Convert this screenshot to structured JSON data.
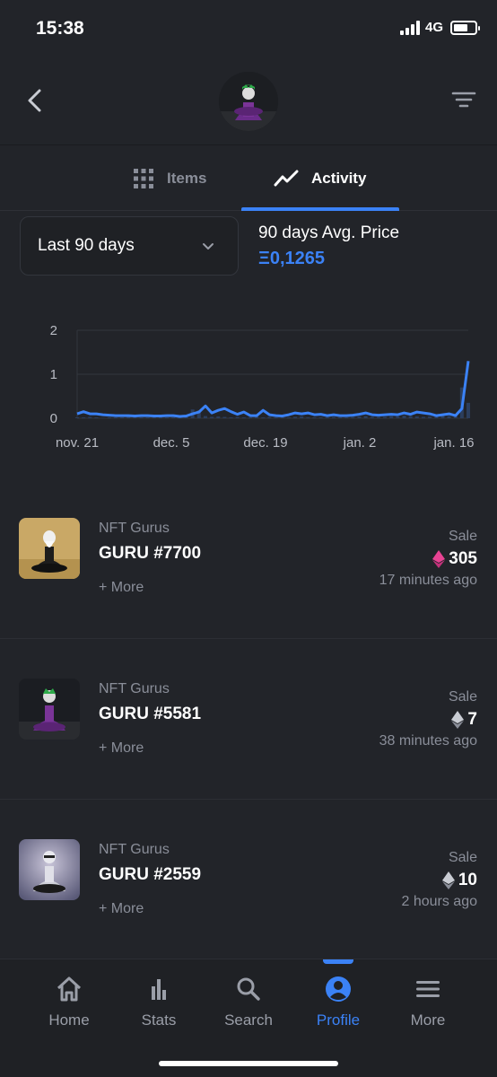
{
  "status_bar": {
    "time": "15:38",
    "network": "4G"
  },
  "tabs": [
    {
      "label": "Items",
      "icon": "grid-icon",
      "active": false
    },
    {
      "label": "Activity",
      "icon": "trend-line-icon",
      "active": true
    }
  ],
  "filter": {
    "selected": "Last 90 days"
  },
  "stats": {
    "avg_label": "90 days Avg. Price",
    "avg_value": "Ξ0,1265"
  },
  "chart_data": {
    "type": "line",
    "x_tick_labels": [
      "nov. 21",
      "dec. 5",
      "dec. 19",
      "jan. 2",
      "jan. 16"
    ],
    "y_ticks": [
      0,
      1,
      2
    ],
    "ylim": [
      0,
      2
    ],
    "grid": true,
    "series": [
      {
        "color": "#3b82f6",
        "values": [
          0.1,
          0.15,
          0.1,
          0.1,
          0.08,
          0.07,
          0.06,
          0.06,
          0.06,
          0.05,
          0.06,
          0.06,
          0.05,
          0.05,
          0.06,
          0.06,
          0.04,
          0.05,
          0.1,
          0.14,
          0.28,
          0.12,
          0.18,
          0.22,
          0.15,
          0.09,
          0.14,
          0.06,
          0.06,
          0.18,
          0.08,
          0.06,
          0.05,
          0.08,
          0.12,
          0.1,
          0.12,
          0.08,
          0.09,
          0.06,
          0.08,
          0.06,
          0.06,
          0.07,
          0.09,
          0.12,
          0.08,
          0.07,
          0.08,
          0.09,
          0.08,
          0.12,
          0.09,
          0.14,
          0.12,
          0.1,
          0.06,
          0.08,
          0.1,
          0.06,
          0.22,
          1.3
        ]
      }
    ],
    "volume_bars": [
      0.02,
      0.02,
      0.03,
      0.02,
      0.01,
      0.02,
      0.02,
      0.02,
      0.03,
      0.02,
      0.02,
      0.02,
      0.02,
      0.02,
      0.02,
      0.02,
      0.03,
      0.04,
      0.2,
      0.18,
      0.05,
      0.03,
      0.04,
      0.03,
      0.02,
      0.03,
      0.02,
      0.02,
      0.04,
      0.02,
      0.03,
      0.02,
      0.02,
      0.02,
      0.03,
      0.04,
      0.02,
      0.02,
      0.02,
      0.02,
      0.03,
      0.02,
      0.02,
      0.03,
      0.04,
      0.05,
      0.03,
      0.03,
      0.03,
      0.05,
      0.04,
      0.06,
      0.05,
      0.04,
      0.03,
      0.04,
      0.04,
      0.08,
      0.05,
      0.1,
      0.7,
      0.35
    ],
    "volume_color": "#2c3e5c"
  },
  "activity": [
    {
      "collection": "NFT Gurus",
      "name": "GURU #7700",
      "more": "+ More",
      "type": "Sale",
      "price": "305",
      "currency_icon": "ethereum-pink-icon",
      "currency_color": "#e84393",
      "time": "17 minutes ago",
      "thumb_bg": "#c9a866",
      "thumb_figure": "#f0f0f0",
      "thumb_robe": "#1c1c1c"
    },
    {
      "collection": "NFT Gurus",
      "name": "GURU #5581",
      "more": "+ More",
      "type": "Sale",
      "price": "7",
      "currency_icon": "ethereum-icon",
      "currency_color": "#c9ccd3",
      "time": "38 minutes ago",
      "thumb_bg": "#1b1d22",
      "thumb_figure": "#dcdcdc",
      "thumb_robe": "#6a2c8a"
    },
    {
      "collection": "NFT Gurus",
      "name": "GURU #2559",
      "more": "+ More",
      "type": "Sale",
      "price": "10",
      "currency_icon": "ethereum-icon",
      "currency_color": "#c9ccd3",
      "time": "2 hours ago",
      "thumb_bg": "#8a8aa8",
      "thumb_figure": "#e8e8ee",
      "thumb_robe": "#cfd0d8"
    }
  ],
  "nav": [
    {
      "label": "Home",
      "icon": "home-icon"
    },
    {
      "label": "Stats",
      "icon": "bar-chart-icon"
    },
    {
      "label": "Search",
      "icon": "search-icon"
    },
    {
      "label": "Profile",
      "icon": "profile-icon",
      "active": true
    },
    {
      "label": "More",
      "icon": "menu-icon"
    }
  ]
}
